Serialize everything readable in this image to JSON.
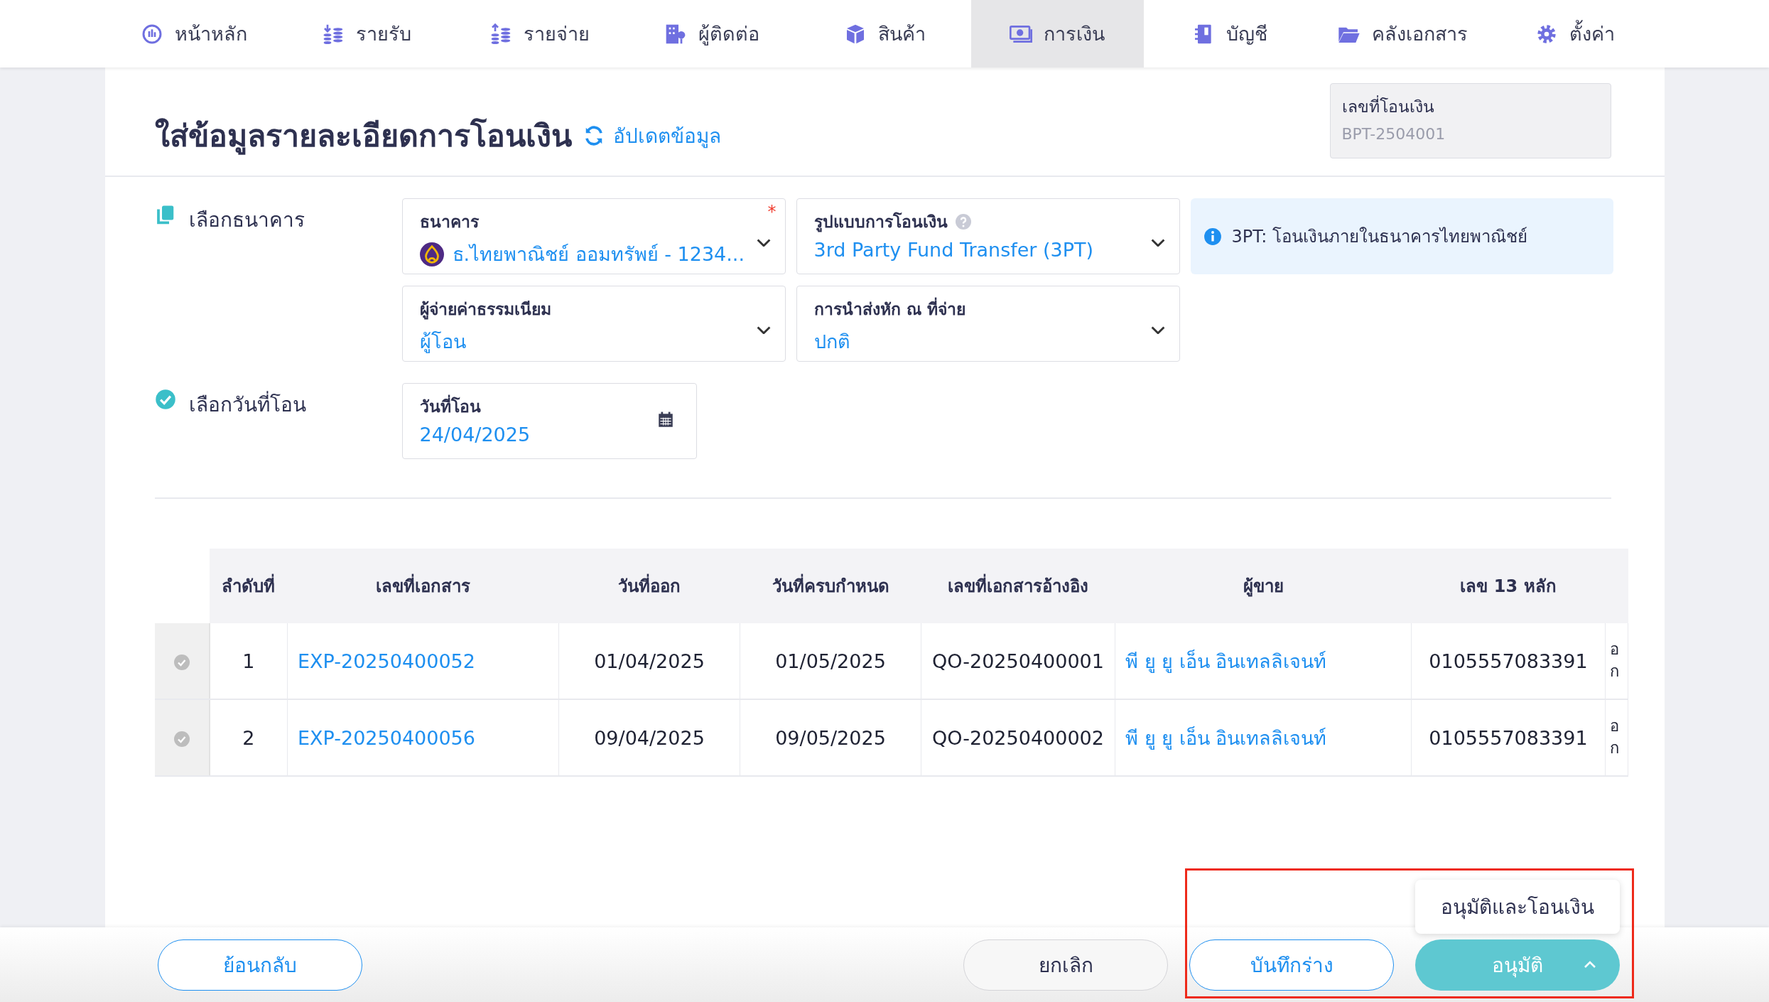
{
  "nav": [
    {
      "label": "หน้าหลัก",
      "selected": false
    },
    {
      "label": "รายรับ",
      "selected": false
    },
    {
      "label": "รายจ่าย",
      "selected": false
    },
    {
      "label": "ผู้ติดต่อ",
      "selected": false
    },
    {
      "label": "สินค้า",
      "selected": false
    },
    {
      "label": "การเงิน",
      "selected": true
    },
    {
      "label": "บัญชี",
      "selected": false
    },
    {
      "label": "คลังเอกสาร",
      "selected": false
    },
    {
      "label": "ตั้งค่า",
      "selected": false
    }
  ],
  "header": {
    "title": "ใส่ข้อมูลรายละเอียดการโอนเงิน",
    "refresh_link": "อัปเดตข้อมูล",
    "doc_number": {
      "label": "เลขที่โอนเงิน",
      "value": "BPT-2504001"
    }
  },
  "sections": [
    {
      "label": "เลือกธนาคาร",
      "fields": [
        {
          "label": "ธนาคาร",
          "value": "ธ.ไทยพาณิชย์ ออมทรัพย์ - 1234...",
          "required_mark": "*",
          "help": false,
          "bank_logo": true,
          "kind": "select"
        },
        {
          "label": "รูปแบบการโอนเงิน",
          "value": "3rd Party Fund Transfer (3PT)",
          "help": true,
          "bank_logo": false,
          "kind": "select"
        },
        {
          "kind": "info",
          "value": "3PT: โอนเงินภายในธนาคารไทยพาณิชย์"
        },
        {
          "label": "ผู้จ่ายค่าธรรมเนียม",
          "value": "ผู้โอน",
          "help": false,
          "bank_logo": false,
          "kind": "select"
        },
        {
          "label": "การนำส่งหัก ณ ที่จ่าย",
          "value": "ปกติ",
          "help": false,
          "bank_logo": false,
          "kind": "select"
        }
      ]
    },
    {
      "label": "เลือกวันที่โอน",
      "fields": [
        {
          "label": "วันที่โอน",
          "value": "24/04/2025",
          "help": false,
          "bank_logo": false,
          "kind": "date"
        }
      ]
    }
  ],
  "table": {
    "columns": [
      "ลำดับที่",
      "เลขที่เอกสาร",
      "วันที่ออก",
      "วันที่ครบกำหนด",
      "เลขที่เอกสารอ้างอิง",
      "ผู้ขาย",
      "เลข 13 หลัก"
    ],
    "rows": [
      {
        "selected": false,
        "cells": [
          "1",
          "EXP-20250400052",
          "01/04/2025",
          "01/05/2025",
          "QO-20250400001",
          "พี ยู ยู เอ็น อินเทลลิเจนท์",
          "0105557083391",
          "อ ก"
        ]
      },
      {
        "selected": false,
        "cells": [
          "2",
          "EXP-20250400056",
          "09/04/2025",
          "09/05/2025",
          "QO-20250400002",
          "พี ยู ยู เอ็น อินเทลลิเจนท์",
          "0105557083391",
          "อ ก"
        ]
      }
    ]
  },
  "footer": {
    "back": "ย้อนกลับ",
    "cancel": "ยกเลิก",
    "draft": "บันทึกร่าง",
    "approve": "อนุมัติ",
    "approve_menu": [
      "อนุมัติและโอนเงิน"
    ],
    "menu_open": true
  }
}
